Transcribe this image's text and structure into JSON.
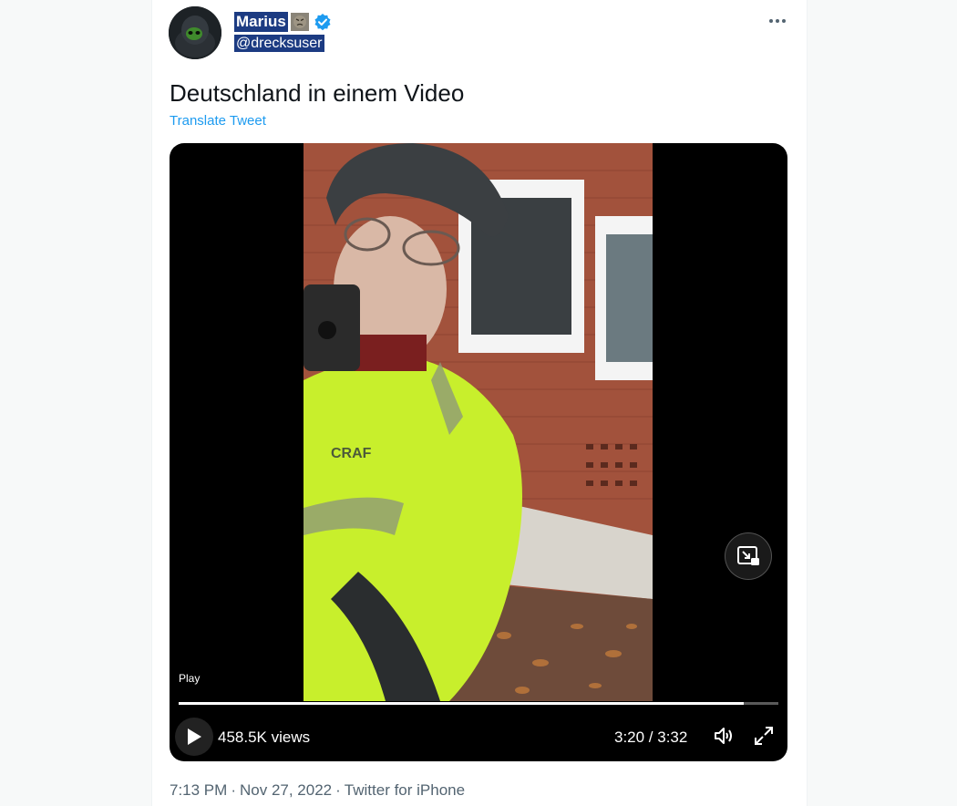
{
  "author": {
    "name": "Marius",
    "handle": "@drecksuser",
    "verified": true,
    "name_emoji": "angry-face-emoji"
  },
  "tweet": {
    "text": "Deutschland in einem Video",
    "translate_label": "Translate Tweet"
  },
  "video": {
    "play_label": "Play",
    "views": "458.5K views",
    "time": "3:20 / 3:32",
    "progress": 0.943
  },
  "meta": {
    "time": "7:13 PM",
    "separator": "·",
    "date": "Nov 27, 2022",
    "source": "Twitter for iPhone"
  },
  "colors": {
    "link": "#1d9bf0",
    "verified": "#1d9bf0",
    "selection": "#1c3b82"
  }
}
